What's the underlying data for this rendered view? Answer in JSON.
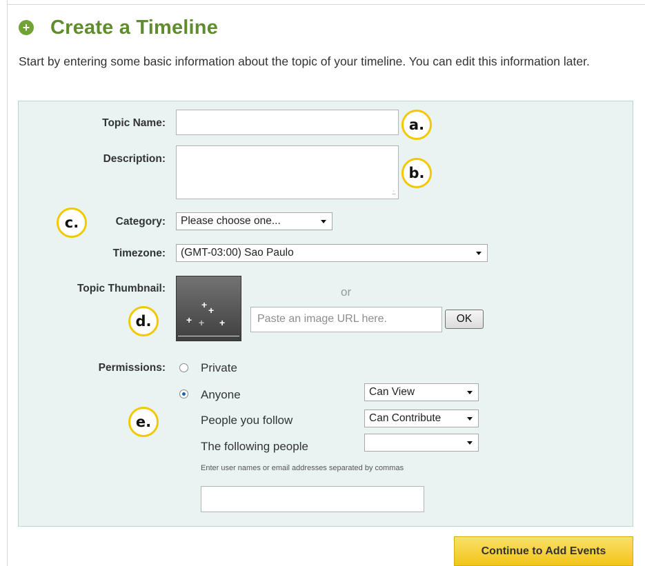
{
  "page": {
    "title": "Create a Timeline",
    "intro": "Start by entering some basic information about the topic of your timeline. You can edit this information later."
  },
  "form": {
    "topic_name_label": "Topic Name:",
    "topic_name_value": "",
    "description_label": "Description:",
    "description_value": "",
    "category_label": "Category:",
    "category_selected": "Please choose one...",
    "timezone_label": "Timezone:",
    "timezone_selected": "(GMT-03:00) Sao Paulo",
    "thumbnail_label": "Topic Thumbnail:",
    "or_text": "or",
    "image_url_placeholder": "Paste an image URL here.",
    "ok_label": "OK",
    "permissions_label": "Permissions:",
    "private_label": "Private",
    "anyone_label": "Anyone",
    "anyone_permission": "Can View",
    "people_follow_label": "People you follow",
    "people_follow_permission": "Can Contribute",
    "following_people_label": "The following people",
    "following_people_permission": "",
    "hint": "Enter user names or email addresses separated by commas",
    "people_input_value": ""
  },
  "continue_label": "Continue to Add Events",
  "callouts": {
    "a": "a.",
    "b": "b.",
    "c": "c.",
    "d": "d.",
    "e": "e."
  },
  "icons": {
    "title_icon": "plus-circle-icon",
    "thumbnail_placeholder": "sparkle-image-icon",
    "select_caret": "caret-down-icon"
  },
  "colors": {
    "title": "#5f8c2c",
    "panel_background": "#e9f3f2",
    "continue_button": "#f2c519",
    "callout_ring": "#f3c800"
  }
}
